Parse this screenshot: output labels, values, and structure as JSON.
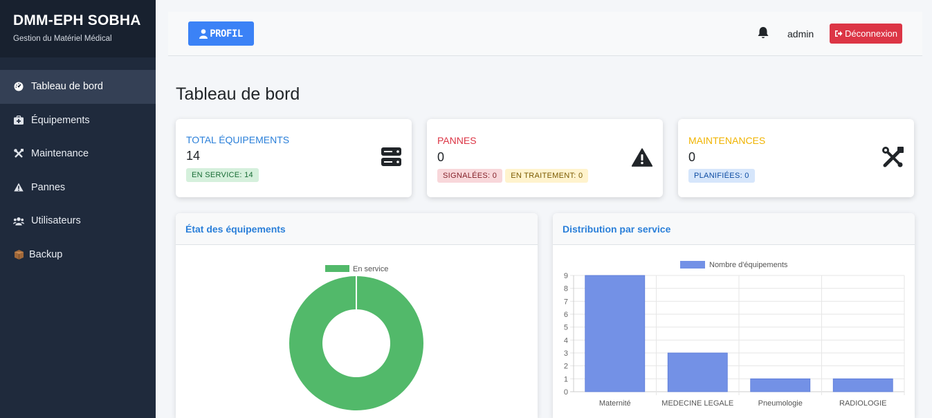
{
  "sidebar": {
    "brand_title": "DMM-EPH SOBHA",
    "brand_subtitle": "Gestion du Matériel Médical",
    "items": [
      {
        "label": "Tableau de bord",
        "icon": "dashboard-icon",
        "active": true
      },
      {
        "label": "Équipements",
        "icon": "medkit-icon",
        "active": false
      },
      {
        "label": "Maintenance",
        "icon": "tools-icon",
        "active": false
      },
      {
        "label": "Pannes",
        "icon": "warning-icon",
        "active": false
      },
      {
        "label": "Utilisateurs",
        "icon": "users-icon",
        "active": false
      },
      {
        "label": "Backup",
        "icon": "box-icon",
        "active": false
      }
    ]
  },
  "topbar": {
    "profile_label": "PROFIL",
    "username": "admin",
    "logout_label": "Déconnexion"
  },
  "page": {
    "title": "Tableau de bord"
  },
  "stats": {
    "equipements": {
      "label": "TOTAL ÉQUIPEMENTS",
      "value": "14",
      "badge_service": "EN SERVICE: 14"
    },
    "pannes": {
      "label": "PANNES",
      "value": "0",
      "badge_signalees": "SIGNALÉES: 0",
      "badge_traitement": "EN TRAITEMENT: 0"
    },
    "maintenances": {
      "label": "MAINTENANCES",
      "value": "0",
      "badge_planifiees": "PLANIFIÉES: 0"
    }
  },
  "colors": {
    "blue": "#2a7fd9",
    "red": "#dc3545",
    "yellow": "#f0b300",
    "green": "#52b96a",
    "bar": "#7391e6"
  },
  "panels": {
    "etat_title": "État des équipements",
    "distribution_title": "Distribution par service"
  },
  "chart_data": [
    {
      "type": "pie",
      "title": "État des équipements",
      "labels": [
        "En service"
      ],
      "values": [
        14
      ],
      "legend": "top"
    },
    {
      "type": "bar",
      "title": "Distribution par service",
      "categories": [
        "Maternité",
        "MEDECINE LEGALE",
        "Pneumologie",
        "RADIOLOGIE"
      ],
      "series": [
        {
          "name": "Nombre d'équipements",
          "values": [
            9,
            3,
            1,
            1
          ]
        }
      ],
      "ylim": [
        0,
        9
      ],
      "yticks": [
        0,
        1,
        2,
        3,
        4,
        5,
        6,
        7,
        8,
        9
      ],
      "grid": true,
      "legend": "top"
    }
  ]
}
